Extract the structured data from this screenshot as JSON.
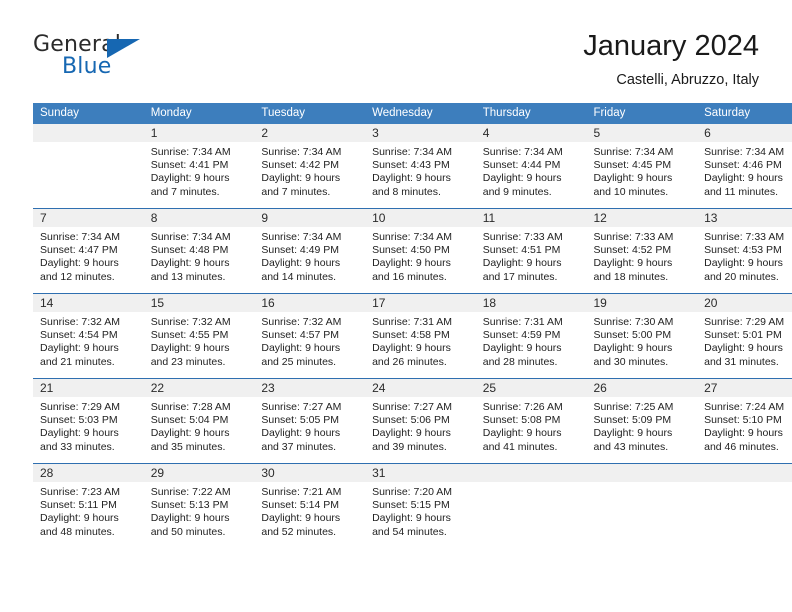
{
  "brand": {
    "name_part1": "General",
    "name_part2": "Blue",
    "logo_icon": "triangle-flag-icon"
  },
  "header": {
    "month_title": "January 2024",
    "location": "Castelli, Abruzzo, Italy"
  },
  "theme": {
    "header_blue": "#3d7ebd",
    "rule_blue": "#2f6fb0",
    "brand_blue": "#1667b2",
    "daynum_band": "#f0f0f0",
    "text": "#222222"
  },
  "calendar": {
    "weekday_headers": [
      "Sunday",
      "Monday",
      "Tuesday",
      "Wednesday",
      "Thursday",
      "Friday",
      "Saturday"
    ],
    "labels": {
      "sunrise_prefix": "Sunrise: ",
      "sunset_prefix": "Sunset: ",
      "daylight_prefix": "Daylight: "
    },
    "weeks": [
      [
        {
          "day": "",
          "empty": true,
          "line1": "",
          "line2": "",
          "line3": "",
          "line4": ""
        },
        {
          "day": "1",
          "line1": "Sunrise: 7:34 AM",
          "line2": "Sunset: 4:41 PM",
          "line3": "Daylight: 9 hours",
          "line4": "and 7 minutes."
        },
        {
          "day": "2",
          "line1": "Sunrise: 7:34 AM",
          "line2": "Sunset: 4:42 PM",
          "line3": "Daylight: 9 hours",
          "line4": "and 7 minutes."
        },
        {
          "day": "3",
          "line1": "Sunrise: 7:34 AM",
          "line2": "Sunset: 4:43 PM",
          "line3": "Daylight: 9 hours",
          "line4": "and 8 minutes."
        },
        {
          "day": "4",
          "line1": "Sunrise: 7:34 AM",
          "line2": "Sunset: 4:44 PM",
          "line3": "Daylight: 9 hours",
          "line4": "and 9 minutes."
        },
        {
          "day": "5",
          "line1": "Sunrise: 7:34 AM",
          "line2": "Sunset: 4:45 PM",
          "line3": "Daylight: 9 hours",
          "line4": "and 10 minutes."
        },
        {
          "day": "6",
          "line1": "Sunrise: 7:34 AM",
          "line2": "Sunset: 4:46 PM",
          "line3": "Daylight: 9 hours",
          "line4": "and 11 minutes."
        }
      ],
      [
        {
          "day": "7",
          "line1": "Sunrise: 7:34 AM",
          "line2": "Sunset: 4:47 PM",
          "line3": "Daylight: 9 hours",
          "line4": "and 12 minutes."
        },
        {
          "day": "8",
          "line1": "Sunrise: 7:34 AM",
          "line2": "Sunset: 4:48 PM",
          "line3": "Daylight: 9 hours",
          "line4": "and 13 minutes."
        },
        {
          "day": "9",
          "line1": "Sunrise: 7:34 AM",
          "line2": "Sunset: 4:49 PM",
          "line3": "Daylight: 9 hours",
          "line4": "and 14 minutes."
        },
        {
          "day": "10",
          "line1": "Sunrise: 7:34 AM",
          "line2": "Sunset: 4:50 PM",
          "line3": "Daylight: 9 hours",
          "line4": "and 16 minutes."
        },
        {
          "day": "11",
          "line1": "Sunrise: 7:33 AM",
          "line2": "Sunset: 4:51 PM",
          "line3": "Daylight: 9 hours",
          "line4": "and 17 minutes."
        },
        {
          "day": "12",
          "line1": "Sunrise: 7:33 AM",
          "line2": "Sunset: 4:52 PM",
          "line3": "Daylight: 9 hours",
          "line4": "and 18 minutes."
        },
        {
          "day": "13",
          "line1": "Sunrise: 7:33 AM",
          "line2": "Sunset: 4:53 PM",
          "line3": "Daylight: 9 hours",
          "line4": "and 20 minutes."
        }
      ],
      [
        {
          "day": "14",
          "line1": "Sunrise: 7:32 AM",
          "line2": "Sunset: 4:54 PM",
          "line3": "Daylight: 9 hours",
          "line4": "and 21 minutes."
        },
        {
          "day": "15",
          "line1": "Sunrise: 7:32 AM",
          "line2": "Sunset: 4:55 PM",
          "line3": "Daylight: 9 hours",
          "line4": "and 23 minutes."
        },
        {
          "day": "16",
          "line1": "Sunrise: 7:32 AM",
          "line2": "Sunset: 4:57 PM",
          "line3": "Daylight: 9 hours",
          "line4": "and 25 minutes."
        },
        {
          "day": "17",
          "line1": "Sunrise: 7:31 AM",
          "line2": "Sunset: 4:58 PM",
          "line3": "Daylight: 9 hours",
          "line4": "and 26 minutes."
        },
        {
          "day": "18",
          "line1": "Sunrise: 7:31 AM",
          "line2": "Sunset: 4:59 PM",
          "line3": "Daylight: 9 hours",
          "line4": "and 28 minutes."
        },
        {
          "day": "19",
          "line1": "Sunrise: 7:30 AM",
          "line2": "Sunset: 5:00 PM",
          "line3": "Daylight: 9 hours",
          "line4": "and 30 minutes."
        },
        {
          "day": "20",
          "line1": "Sunrise: 7:29 AM",
          "line2": "Sunset: 5:01 PM",
          "line3": "Daylight: 9 hours",
          "line4": "and 31 minutes."
        }
      ],
      [
        {
          "day": "21",
          "line1": "Sunrise: 7:29 AM",
          "line2": "Sunset: 5:03 PM",
          "line3": "Daylight: 9 hours",
          "line4": "and 33 minutes."
        },
        {
          "day": "22",
          "line1": "Sunrise: 7:28 AM",
          "line2": "Sunset: 5:04 PM",
          "line3": "Daylight: 9 hours",
          "line4": "and 35 minutes."
        },
        {
          "day": "23",
          "line1": "Sunrise: 7:27 AM",
          "line2": "Sunset: 5:05 PM",
          "line3": "Daylight: 9 hours",
          "line4": "and 37 minutes."
        },
        {
          "day": "24",
          "line1": "Sunrise: 7:27 AM",
          "line2": "Sunset: 5:06 PM",
          "line3": "Daylight: 9 hours",
          "line4": "and 39 minutes."
        },
        {
          "day": "25",
          "line1": "Sunrise: 7:26 AM",
          "line2": "Sunset: 5:08 PM",
          "line3": "Daylight: 9 hours",
          "line4": "and 41 minutes."
        },
        {
          "day": "26",
          "line1": "Sunrise: 7:25 AM",
          "line2": "Sunset: 5:09 PM",
          "line3": "Daylight: 9 hours",
          "line4": "and 43 minutes."
        },
        {
          "day": "27",
          "line1": "Sunrise: 7:24 AM",
          "line2": "Sunset: 5:10 PM",
          "line3": "Daylight: 9 hours",
          "line4": "and 46 minutes."
        }
      ],
      [
        {
          "day": "28",
          "line1": "Sunrise: 7:23 AM",
          "line2": "Sunset: 5:11 PM",
          "line3": "Daylight: 9 hours",
          "line4": "and 48 minutes."
        },
        {
          "day": "29",
          "line1": "Sunrise: 7:22 AM",
          "line2": "Sunset: 5:13 PM",
          "line3": "Daylight: 9 hours",
          "line4": "and 50 minutes."
        },
        {
          "day": "30",
          "line1": "Sunrise: 7:21 AM",
          "line2": "Sunset: 5:14 PM",
          "line3": "Daylight: 9 hours",
          "line4": "and 52 minutes."
        },
        {
          "day": "31",
          "line1": "Sunrise: 7:20 AM",
          "line2": "Sunset: 5:15 PM",
          "line3": "Daylight: 9 hours",
          "line4": "and 54 minutes."
        },
        {
          "day": "",
          "empty": true,
          "line1": "",
          "line2": "",
          "line3": "",
          "line4": ""
        },
        {
          "day": "",
          "empty": true,
          "line1": "",
          "line2": "",
          "line3": "",
          "line4": ""
        },
        {
          "day": "",
          "empty": true,
          "line1": "",
          "line2": "",
          "line3": "",
          "line4": ""
        }
      ]
    ]
  }
}
